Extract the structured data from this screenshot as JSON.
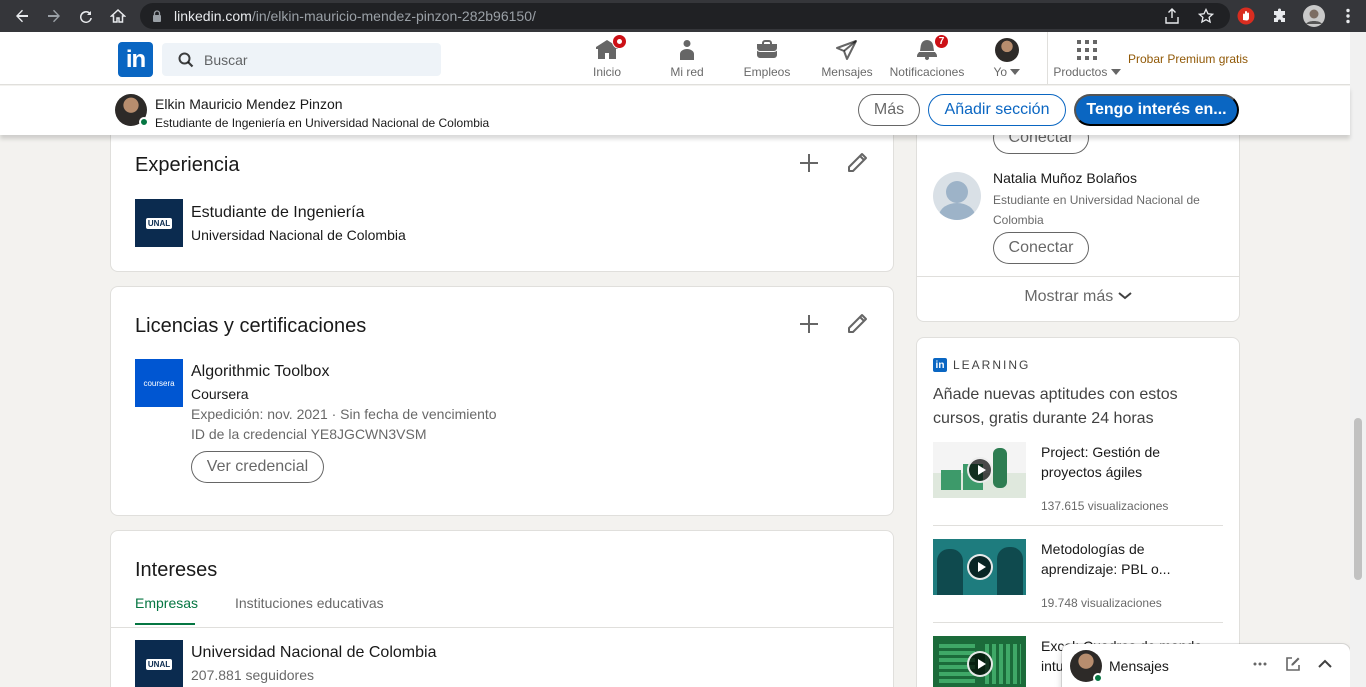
{
  "browser": {
    "url_host": "linkedin.com",
    "url_path": "/in/elkin-mauricio-mendez-pinzon-282b96150/"
  },
  "nav": {
    "search_placeholder": "Buscar",
    "items": [
      {
        "label": "Inicio",
        "badge": ""
      },
      {
        "label": "Mi red",
        "badge": ""
      },
      {
        "label": "Empleos",
        "badge": ""
      },
      {
        "label": "Mensajes",
        "badge": ""
      },
      {
        "label": "Notificaciones",
        "badge": "7"
      },
      {
        "label": "Yo",
        "badge": ""
      },
      {
        "label": "Productos",
        "badge": ""
      }
    ],
    "premium": "Probar Premium gratis"
  },
  "profile": {
    "name": "Elkin Mauricio Mendez Pinzon",
    "headline": "Estudiante de Ingeniería en Universidad Nacional de Colombia",
    "btn_more": "Más",
    "btn_add_section": "Añadir sección",
    "btn_interest": "Tengo interés en..."
  },
  "experience": {
    "title": "Experiencia",
    "items": [
      {
        "logo": "UNAL",
        "role": "Estudiante de Ingeniería",
        "org": "Universidad Nacional de Colombia"
      }
    ]
  },
  "licenses": {
    "title": "Licencias y certificaciones",
    "items": [
      {
        "logo": "coursera",
        "name": "Algorithmic Toolbox",
        "issuer": "Coursera",
        "dates": "Expedición: nov. 2021 · Sin fecha de vencimiento",
        "credential_id": "ID de la credencial YE8JGCWN3VSM",
        "button": "Ver credencial"
      }
    ]
  },
  "interests": {
    "title": "Intereses",
    "tabs": [
      "Empresas",
      "Instituciones educativas"
    ],
    "items": [
      {
        "logo": "UNAL",
        "name": "Universidad Nacional de Colombia",
        "followers": "207.881 seguidores"
      }
    ]
  },
  "people": {
    "partial_button": "Conectar",
    "items": [
      {
        "name": "Natalia Muñoz Bolaños",
        "headline": "Estudiante en Universidad Nacional de Colombia",
        "button": "Conectar"
      }
    ],
    "show_more": "Mostrar más"
  },
  "learning": {
    "brand": "LEARNING",
    "heading": "Añade nuevas aptitudes con estos cursos, gratis durante 24 horas",
    "courses": [
      {
        "title": "Project: Gestión de proyectos ágiles",
        "views": "137.615 visualizaciones"
      },
      {
        "title": "Metodologías de aprendizaje: PBL o...",
        "views": "19.748 visualizaciones"
      },
      {
        "title": "Excel: Cuadros de mando intuitivos",
        "views": ""
      }
    ]
  },
  "messaging": {
    "label": "Mensajes"
  },
  "colors": {
    "brand": "#0a66c2",
    "accent_green": "#057642",
    "badge_red": "#cc1016",
    "premium": "#915907"
  }
}
